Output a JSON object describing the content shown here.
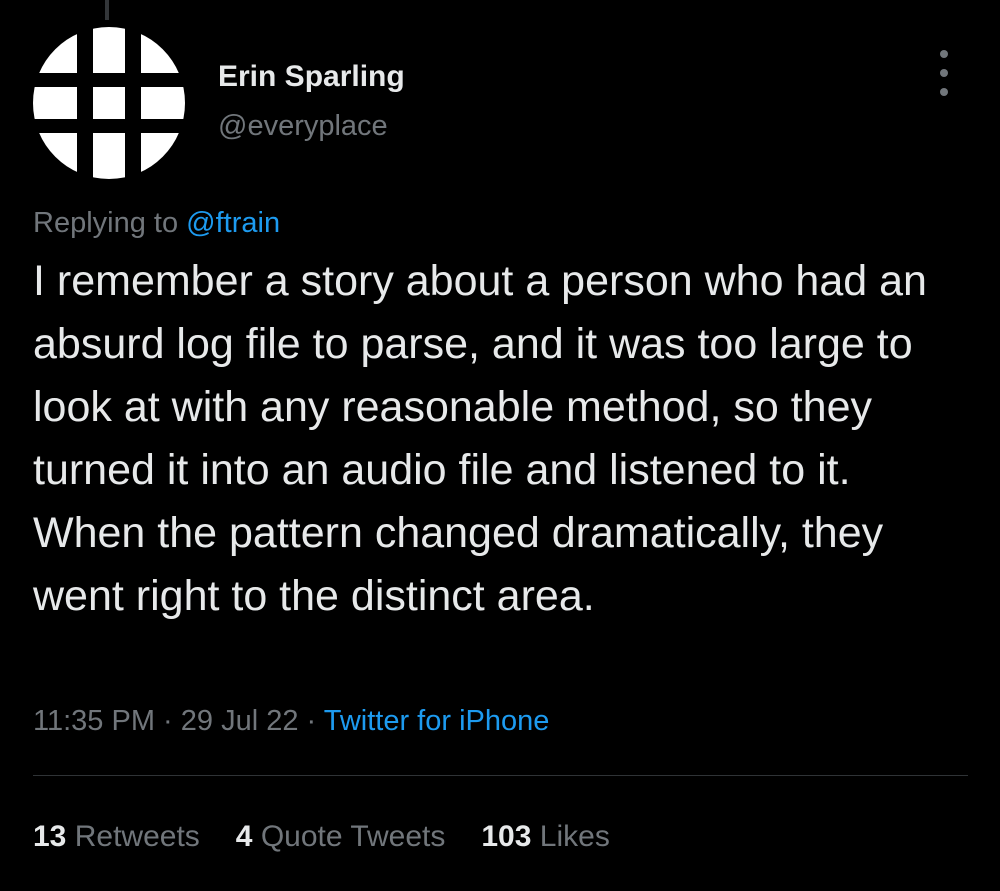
{
  "author": {
    "display_name": "Erin Sparling",
    "handle": "@everyplace",
    "avatar_icon": "circular-logo-avatar"
  },
  "more_icon": "vertical-ellipsis-icon",
  "reply": {
    "prefix": "Replying to ",
    "to_handle": "@ftrain"
  },
  "tweet": {
    "text": "I remember a story about a person who had an absurd log file to parse, and it was too large to look at with any reasonable method, so they turned it into an audio file and listened to it. When the pattern changed dramatically, they went right to the distinct area."
  },
  "meta": {
    "time": "11:35 PM",
    "separator1": " · ",
    "date": "29 Jul 22",
    "separator2": " · ",
    "source": "Twitter for iPhone"
  },
  "stats": {
    "retweets_count": "13",
    "retweets_label": "Retweets",
    "quotes_count": "4",
    "quotes_label": "Quote Tweets",
    "likes_count": "103",
    "likes_label": "Likes"
  },
  "colors": {
    "background": "#000000",
    "primary_text": "#e7e9ea",
    "secondary_text": "#71767b",
    "link": "#1d9bf0",
    "divider": "#2f3336"
  }
}
